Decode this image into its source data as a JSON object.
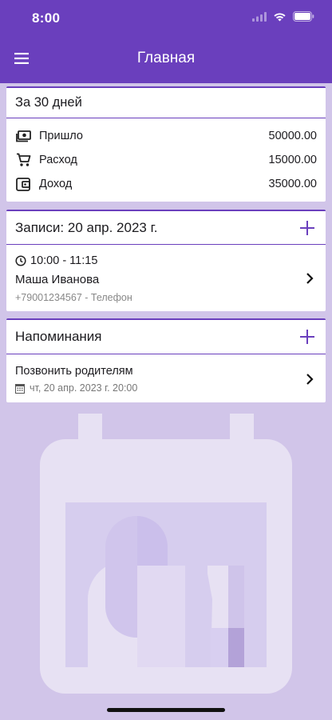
{
  "status_bar": {
    "time": "8:00"
  },
  "header": {
    "title": "Главная"
  },
  "stats": {
    "title": "За 30 дней",
    "rows": [
      {
        "icon": "cash-icon",
        "label": "Пришло",
        "value": "50000.00"
      },
      {
        "icon": "cart-icon",
        "label": "Расход",
        "value": "15000.00"
      },
      {
        "icon": "wallet-icon",
        "label": "Доход",
        "value": "35000.00"
      }
    ]
  },
  "appointments": {
    "title": "Записи: 20 апр. 2023 г.",
    "items": [
      {
        "time": "10:00 - 11:15",
        "name": "Маша Иванова",
        "contact": "+79001234567 - Телефон"
      }
    ]
  },
  "reminders": {
    "title": "Напоминания",
    "items": [
      {
        "text": "Позвонить родителям",
        "date": "чт, 20 апр. 2023 г. 20:00"
      }
    ]
  },
  "colors": {
    "primary": "#6a3fbd",
    "background": "#d1c5e9",
    "card": "#ffffff"
  }
}
